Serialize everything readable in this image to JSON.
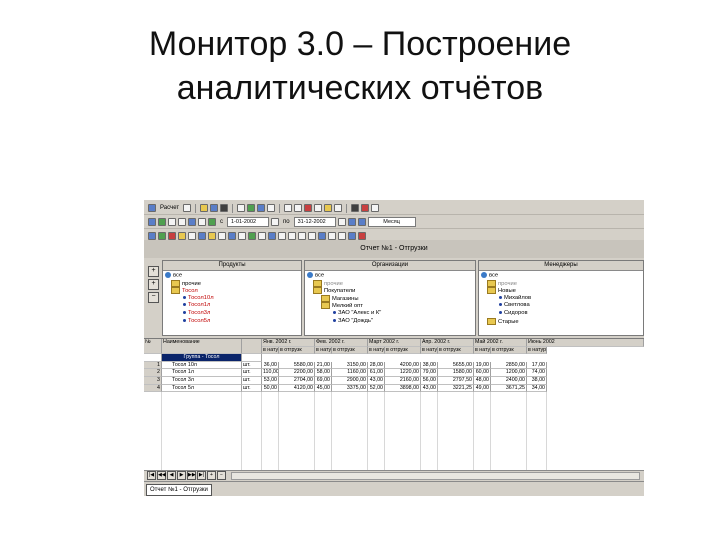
{
  "slide": {
    "title_line1": "Монитор 3.0 – Построение",
    "title_line2": "аналитических отчётов"
  },
  "toolbar1": {
    "calc_label": "Расчет"
  },
  "toolbar2": {
    "from_label": "с",
    "date_from": "1-01-2002",
    "to_label": "по",
    "date_to": "31-12-2002",
    "period": "Месяц"
  },
  "report_title": "Отчет №1 - Отгрузки",
  "panels": {
    "products": {
      "header": "Продукты",
      "items": [
        "все",
        "прочие",
        "Тосол",
        "Тосол10л",
        "Тосол1л",
        "Тосол3л",
        "Тосол5л"
      ]
    },
    "orgs": {
      "header": "Организации",
      "items": [
        "все",
        "прочие",
        "Покупатели",
        "Магазины",
        "Мелкий опт",
        "ЗАО \"Алекс и К\"",
        "ЗАО \"Дождь\""
      ]
    },
    "managers": {
      "header": "Менеджеры",
      "items": [
        "все",
        "прочие",
        "Новые",
        "Михайлов",
        "Светлова",
        "Сидоров",
        "Старые"
      ]
    }
  },
  "left_buttons": [
    "+",
    "+",
    "−"
  ],
  "grid": {
    "col_no": "№",
    "col_name": "Наименование",
    "months": [
      "Янв. 2002 г.",
      "Фев. 2002 г.",
      "Март 2002 г.",
      "Апр. 2002 г.",
      "Май 2002 г.",
      "Июнь 2002"
    ],
    "sub_nat": "в натур",
    "sub_sale": "в отгрузк",
    "group_label": "Группа - Тосол",
    "rows": [
      {
        "no": "1",
        "name": "Тосол 10л",
        "unit": "шт.",
        "vals": [
          "36,00",
          "5580,00",
          "21,00",
          "3150,00",
          "28,00",
          "4200,00",
          "38,00",
          "5655,00",
          "19,00",
          "2850,00",
          "17,00"
        ]
      },
      {
        "no": "2",
        "name": "Тосол 1л",
        "unit": "шт.",
        "vals": [
          "110,00",
          "2200,00",
          "58,00",
          "1160,00",
          "61,00",
          "1220,00",
          "79,00",
          "1580,00",
          "60,00",
          "1200,00",
          "74,00"
        ]
      },
      {
        "no": "3",
        "name": "Тосол 3л",
        "unit": "шт.",
        "vals": [
          "53,00",
          "2704,00",
          "69,00",
          "2900,00",
          "43,00",
          "2160,00",
          "56,00",
          "2797,50",
          "48,00",
          "2400,00",
          "38,00"
        ]
      },
      {
        "no": "4",
        "name": "Тосол 5л",
        "unit": "шт.",
        "vals": [
          "50,00",
          "4120,00",
          "45,00",
          "3375,00",
          "52,00",
          "3898,00",
          "43,00",
          "3221,25",
          "49,00",
          "3671,25",
          "34,00"
        ]
      }
    ]
  },
  "scroll_buttons": [
    "|◀",
    "◀◀",
    "◀",
    "▶",
    "▶▶",
    "▶|",
    "+",
    "−"
  ],
  "tab_label": "Отчет №1 - Отгрузки"
}
